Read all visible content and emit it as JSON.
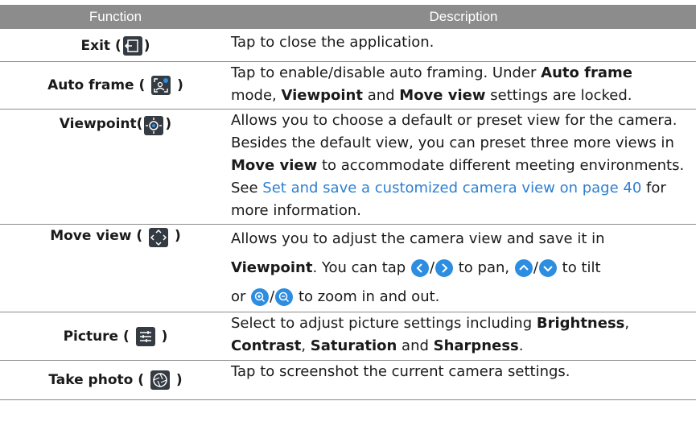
{
  "header": {
    "function": "Function",
    "description": "Description"
  },
  "rows": [
    {
      "name": "Exit",
      "desc": "Tap to close the application."
    },
    {
      "name": "Auto frame",
      "desc_a": "Tap to enable/disable auto framing. Under ",
      "b1": "Auto frame",
      "desc_b": " mode, ",
      "b2": "Viewpoint",
      "desc_c": " and ",
      "b3": "Move view",
      "desc_d": " settings are locked."
    },
    {
      "name": "Viewpoint",
      "desc_a": "Allows you to choose a default or preset view for the camera. Besides the default view, you can preset three more views in ",
      "b1": "Move view",
      "desc_b": " to accommodate different meeting environments. See ",
      "link": "Set and save a customized camera view on page 40",
      "desc_c": " for more information."
    },
    {
      "name": "Move view",
      "desc_a": "Allows you to adjust the camera view and save it in",
      "b1": "Viewpoint",
      "desc_b": ". You can tap ",
      "desc_c": " to pan, ",
      "desc_d": " to tilt",
      "desc_e": "or ",
      "desc_f": " to zoom in and out.",
      "slash": "/"
    },
    {
      "name": "Picture",
      "desc_a": "Select to adjust picture settings including ",
      "b1": "Brightness",
      "desc_b": ", ",
      "b2": "Contrast",
      "desc_c": ", ",
      "b3": "Saturation",
      "desc_d": " and ",
      "b4": "Sharpness",
      "desc_e": "."
    },
    {
      "name": "Take photo",
      "desc": "Tap to screenshot the current camera settings."
    }
  ],
  "colors": {
    "header_bg": "#8c8c8c",
    "link": "#2e7fd1",
    "icon_bg": "#353b42",
    "button_blue": "#2d8de0"
  },
  "icons": [
    "exit-icon",
    "auto-frame-icon",
    "viewpoint-icon",
    "move-view-icon",
    "picture-icon",
    "take-photo-icon",
    "chevron-left-icon",
    "chevron-right-icon",
    "chevron-up-icon",
    "chevron-down-icon",
    "zoom-in-icon",
    "zoom-out-icon"
  ]
}
